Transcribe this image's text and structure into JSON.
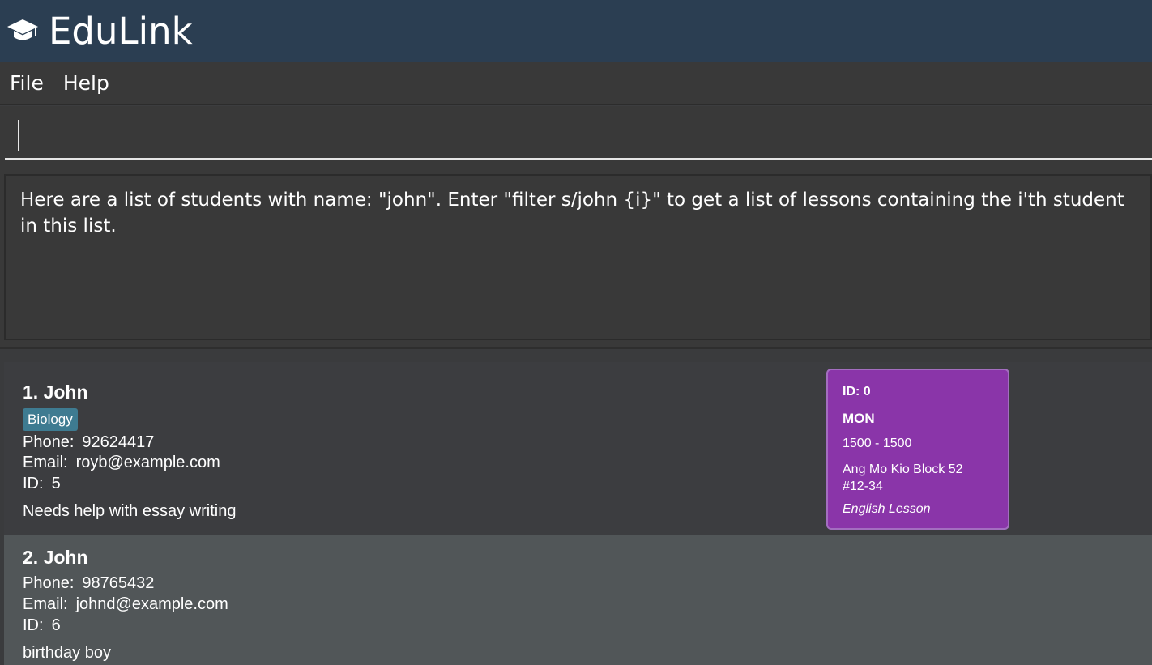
{
  "app": {
    "title": "EduLink",
    "logo_icon": "graduation-cap-icon"
  },
  "menu": {
    "items": [
      "File",
      "Help"
    ]
  },
  "command": {
    "value": "",
    "placeholder": ""
  },
  "result": {
    "message": "Here are a list of students with name: \"john\". Enter \"filter s/john {i}\" to get a list of lessons containing the i'th student in this list."
  },
  "students": [
    {
      "header": "1. John",
      "tag": "Biology",
      "phone_label": "Phone:",
      "phone": "92624417",
      "email_label": "Email:",
      "email": "royb@example.com",
      "id_label": "ID:",
      "id": "5",
      "remark": "Needs help with essay writing",
      "lesson": {
        "id": "ID: 0",
        "day": "MON",
        "time": "1500 - 1500",
        "address": "Ang Mo Kio Block 52 #12-34",
        "subject": "English Lesson"
      }
    },
    {
      "header": "2. John",
      "phone_label": "Phone:",
      "phone": "98765432",
      "email_label": "Email:",
      "email": "johnd@example.com",
      "id_label": "ID:",
      "id": "6",
      "remark": "birthday boy"
    }
  ],
  "colors": {
    "title_bar": "#2b3e52",
    "panel": "#393939",
    "tag": "#3e7b91",
    "lesson_card": "#8a35a9"
  }
}
